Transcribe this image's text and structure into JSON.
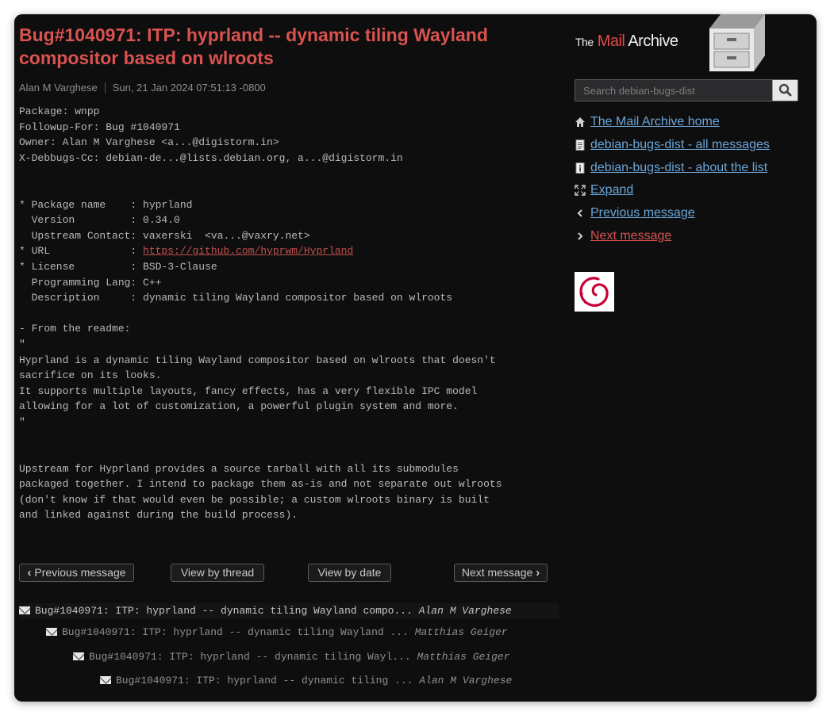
{
  "message": {
    "subject": "Bug#1040971: ITP: hyprland -- dynamic tiling Wayland compositor based on wlroots",
    "author": "Alan M Varghese",
    "date": "Sun, 21 Jan 2024 07:51:13 -0800",
    "body_before_link": "Package: wnpp\nFollowup-For: Bug #1040971\nOwner: Alan M Varghese <a...@digistorm.in>\nX-Debbugs-Cc: debian-de...@lists.debian.org, a...@digistorm.in\n\n\n* Package name    : hyprland\n  Version         : 0.34.0\n  Upstream Contact: vaxerski  <va...@vaxry.net>\n* URL             : ",
    "url": "https://github.com/hyprwm/Hyprland",
    "body_after_link": "\n* License         : BSD-3-Clause\n  Programming Lang: C++\n  Description     : dynamic tiling Wayland compositor based on wlroots\n\n- From the readme:\n\"\nHyprland is a dynamic tiling Wayland compositor based on wlroots that doesn't\nsacrifice on its looks.\nIt supports multiple layouts, fancy effects, has a very flexible IPC model\nallowing for a lot of customization, a powerful plugin system and more.\n\"\n\n\nUpstream for Hyprland provides a source tarball with all its submodules\npackaged together. I intend to package them as-is and not separate out wlroots\n(don't know if that would even be possible; a custom wlroots binary is built\nand linked against during the build process)."
  },
  "nav": {
    "previous": "Previous message",
    "by_thread": "View by thread",
    "by_date": "View by date",
    "next": "Next message"
  },
  "thread": [
    {
      "subject": "Bug#1040971: ITP: hyprland -- dynamic tiling Wayland compo...",
      "author": "Alan M Varghese"
    },
    {
      "subject": "Bug#1040971: ITP: hyprland -- dynamic tiling Wayland ...",
      "author": "Matthias Geiger"
    },
    {
      "subject": "Bug#1040971: ITP: hyprland -- dynamic tiling Wayl...",
      "author": "Matthias Geiger"
    },
    {
      "subject": "Bug#1040971: ITP: hyprland -- dynamic tiling ...",
      "author": "Alan M Varghese"
    }
  ],
  "sidebar": {
    "logo_the": "The",
    "logo_mail": "Mail",
    "logo_archive": "Archive",
    "search_placeholder": "Search debian-bugs-dist",
    "links": {
      "home": "The Mail Archive home",
      "all_messages": "debian-bugs-dist - all messages",
      "about": "debian-bugs-dist - about the list",
      "expand": "Expand",
      "previous": "Previous message",
      "next": "Next message"
    }
  },
  "colors": {
    "background": "#0f0e0f",
    "subject": "#d9534f",
    "link": "#6aa6d8",
    "link_active": "#d9534f",
    "text": "#b9b9b9"
  },
  "icons": [
    "home-icon",
    "document-icon",
    "info-document-icon",
    "expand-icon",
    "chevron-left-icon",
    "chevron-right-icon",
    "envelope-icon",
    "magnifier-icon",
    "file-cabinet-icon",
    "debian-swirl-icon"
  ]
}
